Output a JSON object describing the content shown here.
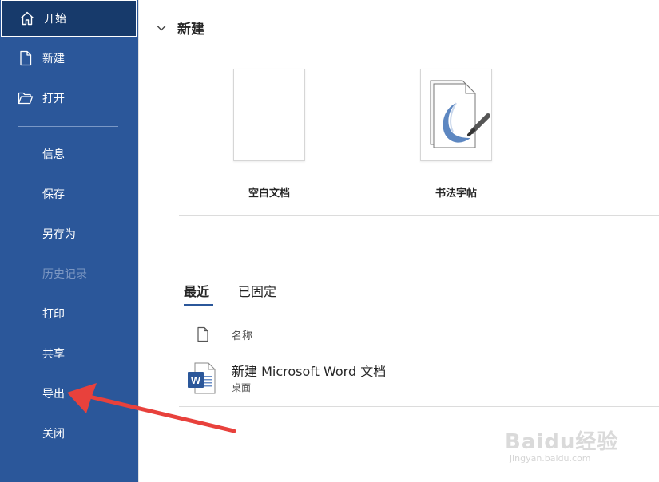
{
  "sidebar": {
    "items": [
      {
        "label": "开始",
        "icon": "home-icon",
        "active": true
      },
      {
        "label": "新建",
        "icon": "document-icon"
      },
      {
        "label": "打开",
        "icon": "folder-open-icon"
      },
      {
        "label": "信息"
      },
      {
        "label": "保存"
      },
      {
        "label": "另存为"
      },
      {
        "label": "历史记录",
        "disabled": true
      },
      {
        "label": "打印"
      },
      {
        "label": "共享"
      },
      {
        "label": "导出"
      },
      {
        "label": "关闭"
      }
    ]
  },
  "main": {
    "new_section": {
      "title": "新建",
      "icon": "chevron-down-icon",
      "templates": [
        {
          "name": "空白文档"
        },
        {
          "name": "书法字帖",
          "icon": "calligraphy-brush-icon"
        }
      ]
    },
    "tabs": [
      {
        "label": "最近",
        "active": true
      },
      {
        "label": "已固定"
      }
    ],
    "list": {
      "column_header": "名称",
      "header_icon": "file-icon",
      "files": [
        {
          "name": "新建 Microsoft Word 文档",
          "location": "桌面",
          "icon": "word-document-icon"
        }
      ]
    }
  },
  "annotation": {
    "type": "red-arrow",
    "points_to": "导出",
    "color": "#e8413c"
  },
  "watermark": {
    "text": "Baidu经验",
    "sub": "jingyan.baidu.com"
  },
  "colors": {
    "sidebar": "#2b579a",
    "sidebar_active": "#173a6b",
    "accent": "#2b579a"
  }
}
